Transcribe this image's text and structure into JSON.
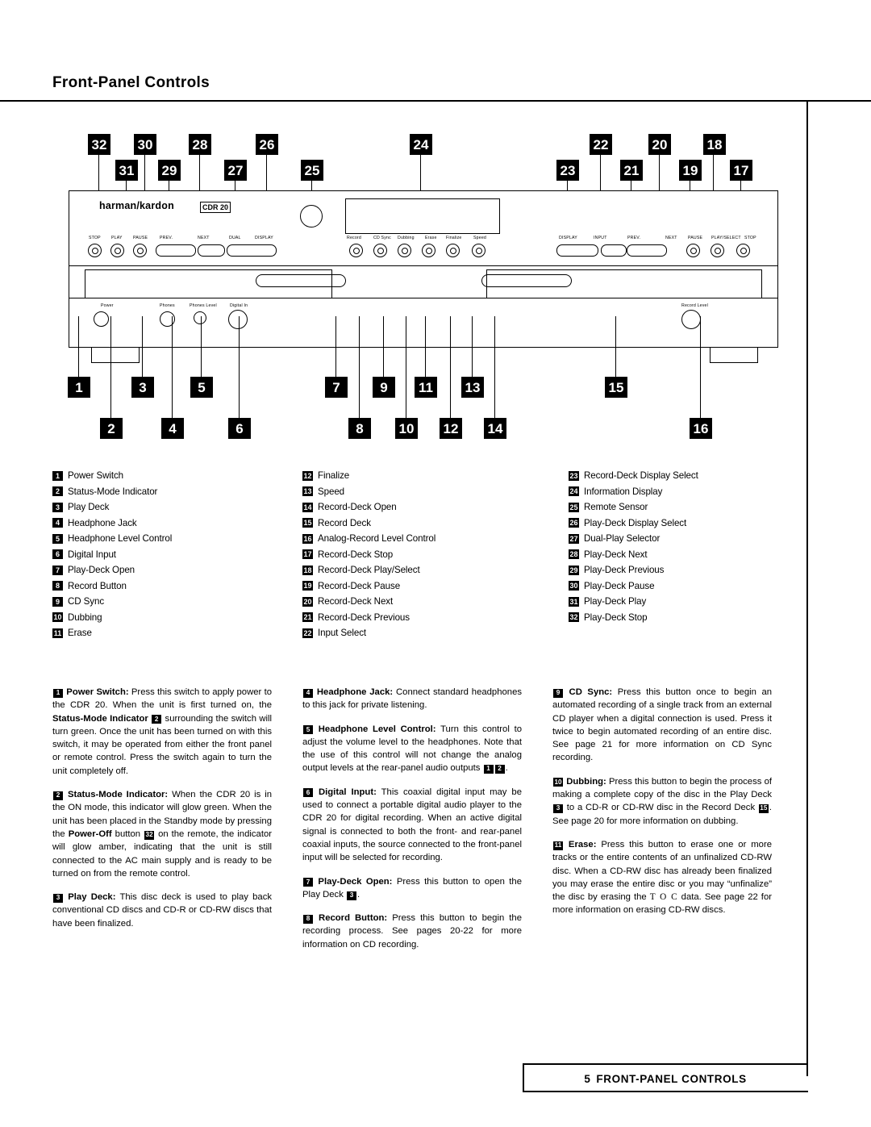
{
  "page": {
    "title": "Front-Panel Controls",
    "footer_page_number": "5",
    "footer_text": "FRONT-PANEL CONTROLS"
  },
  "device": {
    "brand": "harman/kardon",
    "model": "CDR 20",
    "play_deck_buttons": [
      "STOP",
      "PLAY",
      "PAUSE",
      "PREV.",
      "NEXT",
      "DUAL",
      "DISPLAY"
    ],
    "center_buttons": [
      "Record",
      "CD Sync",
      "Dubbing",
      "Erase",
      "Finalize",
      "Speed"
    ],
    "record_deck_buttons": [
      "DISPLAY",
      "INPUT",
      "PREV.",
      "NEXT",
      "PAUSE",
      "PLAY/SELECT",
      "STOP"
    ],
    "lower_labels": [
      "Power",
      "Phones",
      "Phones Level",
      "Digital In",
      "Record Level"
    ]
  },
  "top_callouts": {
    "row1": [
      "32",
      "30",
      "28",
      "26",
      "24",
      "22",
      "20",
      "18"
    ],
    "row2": [
      "31",
      "29",
      "27",
      "25",
      "23",
      "21",
      "19",
      "17"
    ]
  },
  "bottom_callouts": {
    "row1": [
      "1",
      "3",
      "5",
      "7",
      "9",
      "11",
      "13",
      "15"
    ],
    "row2": [
      "2",
      "4",
      "6",
      "8",
      "10",
      "12",
      "14",
      "16"
    ]
  },
  "index": {
    "column1": [
      {
        "n": "1",
        "t": "Power Switch"
      },
      {
        "n": "2",
        "t": "Status-Mode Indicator"
      },
      {
        "n": "3",
        "t": "Play Deck"
      },
      {
        "n": "4",
        "t": "Headphone Jack"
      },
      {
        "n": "5",
        "t": "Headphone Level Control"
      },
      {
        "n": "6",
        "t": "Digital Input"
      },
      {
        "n": "7",
        "t": "Play-Deck Open"
      },
      {
        "n": "8",
        "t": "Record Button"
      },
      {
        "n": "9",
        "t": "CD Sync"
      },
      {
        "n": "10",
        "t": "Dubbing"
      },
      {
        "n": "11",
        "t": "Erase"
      }
    ],
    "column2": [
      {
        "n": "12",
        "t": "Finalize"
      },
      {
        "n": "13",
        "t": "Speed"
      },
      {
        "n": "14",
        "t": "Record-Deck Open"
      },
      {
        "n": "15",
        "t": "Record Deck"
      },
      {
        "n": "16",
        "t": "Analog-Record Level Control"
      },
      {
        "n": "17",
        "t": "Record-Deck Stop"
      },
      {
        "n": "18",
        "t": "Record-Deck Play/Select"
      },
      {
        "n": "19",
        "t": "Record-Deck Pause"
      },
      {
        "n": "20",
        "t": "Record-Deck Next"
      },
      {
        "n": "21",
        "t": "Record-Deck Previous"
      },
      {
        "n": "22",
        "t": "Input Select"
      }
    ],
    "column3": [
      {
        "n": "23",
        "t": "Record-Deck Display Select"
      },
      {
        "n": "24",
        "t": "Information Display"
      },
      {
        "n": "25",
        "t": "Remote Sensor"
      },
      {
        "n": "26",
        "t": "Play-Deck Display Select"
      },
      {
        "n": "27",
        "t": "Dual-Play Selector"
      },
      {
        "n": "28",
        "t": "Play-Deck Next"
      },
      {
        "n": "29",
        "t": "Play-Deck Previous"
      },
      {
        "n": "30",
        "t": "Play-Deck Pause"
      },
      {
        "n": "31",
        "t": "Play-Deck Play"
      },
      {
        "n": "32",
        "t": "Play-Deck Stop"
      }
    ]
  },
  "descriptions": {
    "col1": [
      {
        "id": "1",
        "title": "Power Switch:",
        "html": "Press this switch to apply power to the CDR 20. When the unit is first turned on, the <b>Status-Mode Indicator</b> <span class=\"inlinenum\">2</span> surrounding the switch will turn green. Once the unit has been turned on with this switch, it may be operated from either the front panel or remote control. Press the switch again to turn the unit completely off."
      },
      {
        "id": "2",
        "title": "Status-Mode Indicator:",
        "html": "When the CDR 20 is in the ON mode, this indicator will glow green. When the unit has been placed in the Standby mode by pressing the <b>Power-Off</b> button <span class=\"inlinenum\">32</span> on the remote, the indicator will glow amber, indicating that the unit is still connected to the AC main supply and is ready to be turned on from the remote control."
      },
      {
        "id": "3",
        "title": "Play Deck:",
        "html": "This disc deck is used to play back conventional CD discs and CD-R or CD-RW discs that have been finalized."
      }
    ],
    "col2": [
      {
        "id": "4",
        "title": "Headphone Jack:",
        "html": "Connect standard headphones to this jack for private listening."
      },
      {
        "id": "5",
        "title": "Headphone Level Control:",
        "html": "Turn this control to adjust the volume level to the headphones. Note that the use of this control will not change the analog output levels at the rear-panel audio outputs <span class=\"inlinenum\">1</span><span class=\"inlinenum\">2</span>."
      },
      {
        "id": "6",
        "title": "Digital Input:",
        "html": "This coaxial digital input may be used to connect a portable digital audio player to the CDR 20 for digital recording. When an active digital signal is connected to both the front- and rear-panel coaxial inputs, the source connected to the front-panel input will be selected for recording."
      },
      {
        "id": "7",
        "title": "Play-Deck Open:",
        "html": "Press this button to open the Play Deck <span class=\"inlinenum\">3</span>."
      },
      {
        "id": "8",
        "title": "Record Button:",
        "html": "Press this button to begin the recording process. See pages 20-22 for more information on CD recording."
      }
    ],
    "col3": [
      {
        "id": "9",
        "title": "CD Sync:",
        "html": "Press this button once to begin an automated recording of a single track from an external CD player when a digital connection is used. Press it twice to begin automated recording of an entire disc. See page 21 for more information on CD Sync recording."
      },
      {
        "id": "10",
        "title": "Dubbing:",
        "html": "Press this button to begin the process of making a complete copy of the disc in the Play Deck <span class=\"inlinenum\">3</span> to a CD-R or CD-RW disc in the Record Deck <span class=\"inlinenum\">15</span>. See page 20 for more information on dubbing."
      },
      {
        "id": "11",
        "title": "Erase:",
        "html": "Press this button to erase one or more tracks or the entire contents of an unfinalized CD-RW disc. When a CD-RW disc has already been finalized you may erase the entire disc or you may “unfinalize” the disc by erasing the <span class=\"toc-glyph\">T O C</span> data. See page 22 for more information on erasing CD-RW discs."
      }
    ]
  }
}
